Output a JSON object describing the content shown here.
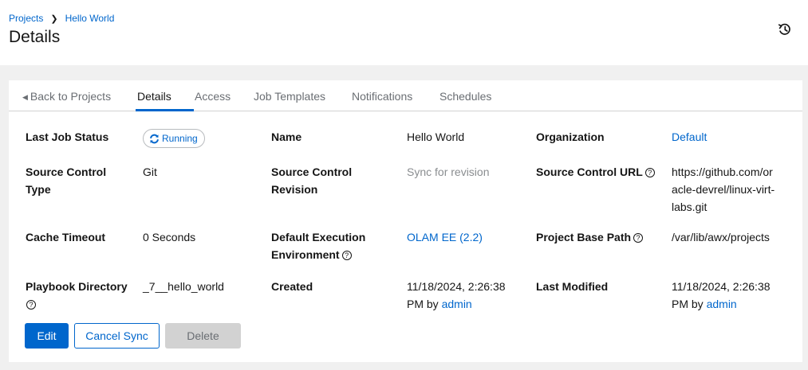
{
  "breadcrumb": {
    "items": [
      "Projects",
      "Hello World"
    ]
  },
  "page": {
    "title": "Details"
  },
  "tabs": [
    "Back to Projects",
    "Details",
    "Access",
    "Job Templates",
    "Notifications",
    "Schedules"
  ],
  "details": {
    "last_job_status_label": "Last Job Status",
    "last_job_status_value": "Running",
    "name_label": "Name",
    "name_value": "Hello World",
    "organization_label": "Organization",
    "organization_value": "Default",
    "scm_type_label_1": "Source Control",
    "scm_type_label_2": "Type",
    "scm_type_value": "Git",
    "scm_revision_label_1": "Source Control",
    "scm_revision_label_2": "Revision",
    "scm_revision_value": "Sync for revision",
    "scm_url_label": "Source Control URL",
    "scm_url_value_1": "https://github.com/or",
    "scm_url_value_2": "acle-devrel/linux-virt-",
    "scm_url_value_3": "labs.git",
    "cache_timeout_label": "Cache Timeout",
    "cache_timeout_value": "0 Seconds",
    "default_ee_label_1": "Default Execution",
    "default_ee_label_2": "Environment",
    "default_ee_value": "OLAM EE (2.2)",
    "base_path_label": "Project Base Path",
    "base_path_value": "/var/lib/awx/projects",
    "playbook_dir_label": "Playbook Directory",
    "playbook_dir_value": "_7__hello_world",
    "created_label": "Created",
    "created_date": "11/18/2024, 2:26:38",
    "created_by_prefix": "PM by",
    "created_by_user": "admin",
    "modified_label": "Last Modified",
    "modified_date": "11/18/2024, 2:26:38",
    "modified_by_prefix": "PM by",
    "modified_by_user": "admin",
    "help_glyph": "?"
  },
  "actions": {
    "edit": "Edit",
    "cancel_sync": "Cancel Sync",
    "delete": "Delete"
  },
  "colors": {
    "link": "#0066cc",
    "muted": "#8a8d90",
    "background": "#f0f0f0",
    "disabled": "#d2d2d2"
  }
}
